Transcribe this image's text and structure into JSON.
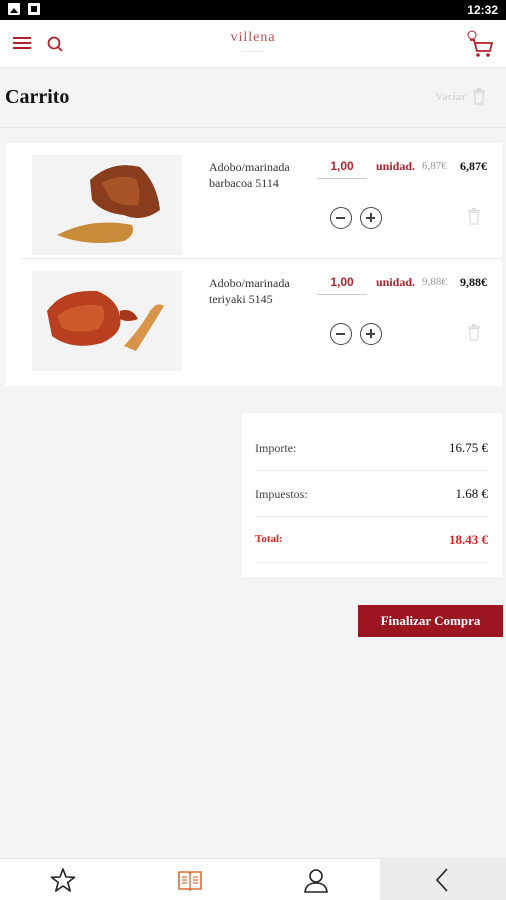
{
  "status_bar": {
    "time": "12:32"
  },
  "header": {
    "logo": "villena",
    "logo_sub": "................"
  },
  "page": {
    "title": "Carrito",
    "empty_label": "Vaciar"
  },
  "colors": {
    "accent": "#b3202a",
    "total": "#e02020",
    "button": "#9b1620"
  },
  "items": [
    {
      "name": "Adobo/marinada barbacoa 5114",
      "qty": "1,00",
      "unit": "unidad.",
      "unit_price": "6,87€",
      "line_price": "6,87€"
    },
    {
      "name": "Adobo/marinada teriyaki 5145",
      "qty": "1,00",
      "unit": "unidad.",
      "unit_price": "9,88€",
      "line_price": "9,88€"
    }
  ],
  "totals": {
    "importe_label": "Importe:",
    "importe": "16.75 €",
    "impuestos_label": "Impuestos:",
    "impuestos": "1.68 €",
    "total_label": "Total:",
    "total": "18.43 €"
  },
  "checkout": {
    "label": "Finalizar Compra"
  },
  "bottom_nav": [
    {
      "icon": "star-icon"
    },
    {
      "icon": "catalog-book-icon"
    },
    {
      "icon": "user-icon"
    },
    {
      "icon": "back-chevron-icon"
    }
  ]
}
